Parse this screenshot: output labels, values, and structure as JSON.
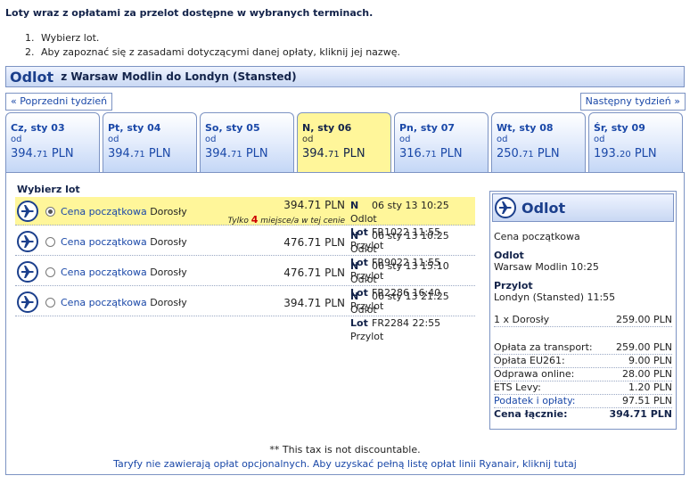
{
  "intro": "Loty wraz z opłatami za przelot dostępne w wybranych terminach.",
  "steps": [
    {
      "num": "1.",
      "text": "Wybierz lot."
    },
    {
      "num": "2.",
      "text": "Aby zapoznać się z zasadami dotyczącymi danej opłaty, kliknij jej nazwę."
    }
  ],
  "section": {
    "title": "Odlot",
    "route": "z Warsaw Modlin do Londyn (Stansted)"
  },
  "nav": {
    "prev": "« Poprzedni tydzień",
    "next": "Następny tydzień »"
  },
  "days": [
    {
      "label": "Cz, sty 03",
      "od": "od",
      "price_main": "394.",
      "price_cents": "71",
      "currency": " PLN",
      "selected": false
    },
    {
      "label": "Pt, sty 04",
      "od": "od",
      "price_main": "394.",
      "price_cents": "71",
      "currency": " PLN",
      "selected": false
    },
    {
      "label": "So, sty 05",
      "od": "od",
      "price_main": "394.",
      "price_cents": "71",
      "currency": " PLN",
      "selected": false
    },
    {
      "label": "N, sty 06",
      "od": "od",
      "price_main": "394.",
      "price_cents": "71",
      "currency": " PLN",
      "selected": true
    },
    {
      "label": "Pn, sty 07",
      "od": "od",
      "price_main": "316.",
      "price_cents": "71",
      "currency": " PLN",
      "selected": false
    },
    {
      "label": "Wt, sty 08",
      "od": "od",
      "price_main": "250.",
      "price_cents": "71",
      "currency": " PLN",
      "selected": false
    },
    {
      "label": "Śr, sty 09",
      "od": "od",
      "price_main": "193.",
      "price_cents": "20",
      "currency": " PLN",
      "selected": false
    }
  ],
  "wybierz": "Wybierz lot",
  "flights": [
    {
      "fare": "Cena początkowa",
      "pax": "Dorosły",
      "price": "394.71 PLN",
      "selected": true,
      "tylko_pre": "Tylko ",
      "tylko_count": "4",
      "tylko_post": " miejsce/a w tej cenie",
      "n_label": "N",
      "date": "06 sty 13",
      "dep_time": "10:25",
      "dep_word": "Odlot",
      "lot_label": "Lot",
      "flight_no": "FR1022",
      "arr_time": "11:55",
      "arr_word": "Przylot"
    },
    {
      "fare": "Cena początkowa",
      "pax": "Dorosły",
      "price": "476.71 PLN",
      "selected": false,
      "n_label": "N",
      "date": "06 sty 13",
      "dep_time": "10:25",
      "dep_word": "Odlot",
      "lot_label": "Lot",
      "flight_no": "FR9022",
      "arr_time": "11:55",
      "arr_word": "Przylot"
    },
    {
      "fare": "Cena początkowa",
      "pax": "Dorosły",
      "price": "476.71 PLN",
      "selected": false,
      "n_label": "N",
      "date": "06 sty 13",
      "dep_time": "15:10",
      "dep_word": "Odlot",
      "lot_label": "Lot",
      "flight_no": "FR2286",
      "arr_time": "16:40",
      "arr_word": "Przylot"
    },
    {
      "fare": "Cena początkowa",
      "pax": "Dorosły",
      "price": "394.71 PLN",
      "selected": false,
      "n_label": "N",
      "date": "06 sty 13",
      "dep_time": "21:25",
      "dep_word": "Odlot",
      "lot_label": "Lot",
      "flight_no": "FR2284",
      "arr_time": "22:55",
      "arr_word": "Przylot"
    }
  ],
  "summary": {
    "title": "Odlot",
    "fare": "Cena początkowa",
    "odlot_label": "Odlot",
    "odlot_value": "Warsaw Modlin 10:25",
    "przylot_label": "Przylot",
    "przylot_value": "Londyn (Stansted) 11:55",
    "pax_label": "1 x Dorosły",
    "pax_value": "259.00 PLN",
    "fees": [
      {
        "label": "Opłata za transport:",
        "value": "259.00 PLN"
      },
      {
        "label": "Opłata EU261:",
        "value": "9.00 PLN"
      },
      {
        "label": "Odprawa online:",
        "value": "28.00 PLN"
      },
      {
        "label": "ETS Levy:",
        "value": "1.20 PLN"
      },
      {
        "label": "Podatek i opłaty:",
        "value": "97.51 PLN"
      }
    ],
    "total_label": "Cena łącznie:",
    "total_value": "394.71 PLN"
  },
  "footer": {
    "tax_note": "** This tax is not discountable.",
    "link": "Taryfy nie zawierają opłat opcjonalnych. Aby uzyskać pełną listę opłat linii Ryanair, kliknij tutaj"
  },
  "colors": {
    "accent": "#1a48a8",
    "highlight": "#fff69a",
    "border": "#7c93c3"
  }
}
